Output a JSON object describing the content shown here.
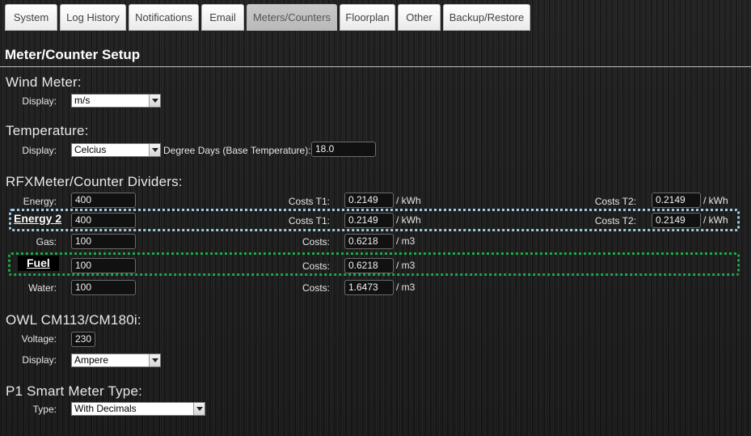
{
  "tabs": [
    {
      "label": "System"
    },
    {
      "label": "Log History"
    },
    {
      "label": "Notifications"
    },
    {
      "label": "Email"
    },
    {
      "label": "Meters/Counters"
    },
    {
      "label": "Floorplan"
    },
    {
      "label": "Other"
    },
    {
      "label": "Backup/Restore"
    }
  ],
  "page_title": "Meter/Counter Setup",
  "wind": {
    "title": "Wind Meter:",
    "display_label": "Display:",
    "display_value": "m/s"
  },
  "temperature": {
    "title": "Temperature:",
    "display_label": "Display:",
    "display_value": "Celcius",
    "degree_days_label": "Degree Days (Base Temperature):",
    "degree_days_value": "18.0"
  },
  "rfx": {
    "title": "RFXMeter/Counter Dividers:",
    "energy": {
      "label": "Energy:",
      "value": "400",
      "costs_t1_label": "Costs T1:",
      "costs_t1": "0.2149",
      "unit1": "/ kWh",
      "costs_t2_label": "Costs T2:",
      "costs_t2": "0.2149",
      "unit2": "/ kWh"
    },
    "energy2": {
      "callout": "Energy 2",
      "value": "400",
      "costs_t1_label": "Costs T1:",
      "costs_t1": "0.2149",
      "unit1": "/ kWh",
      "costs_t2_label": "Costs T2:",
      "costs_t2": "0.2149",
      "unit2": "/ kWh"
    },
    "gas": {
      "label": "Gas:",
      "value": "100",
      "costs_label": "Costs:",
      "costs": "0.6218",
      "unit": "/ m3"
    },
    "fuel": {
      "callout": "Fuel",
      "value": "100",
      "costs_label": "Costs:",
      "costs": "0.6218",
      "unit": "/ m3"
    },
    "water": {
      "label": "Water:",
      "value": "100",
      "costs_label": "Costs:",
      "costs": "1.6473",
      "unit": "/ m3"
    }
  },
  "owl": {
    "title": "OWL CM113/CM180i:",
    "voltage_label": "Voltage:",
    "voltage_value": "230",
    "display_label": "Display:",
    "display_value": "Ampere"
  },
  "p1": {
    "title": "P1 Smart Meter Type:",
    "type_label": "Type:",
    "type_value": "With Decimals"
  },
  "colors": {
    "highlight_energy2": "#9fcbe3",
    "highlight_fuel": "#1ea84a"
  }
}
